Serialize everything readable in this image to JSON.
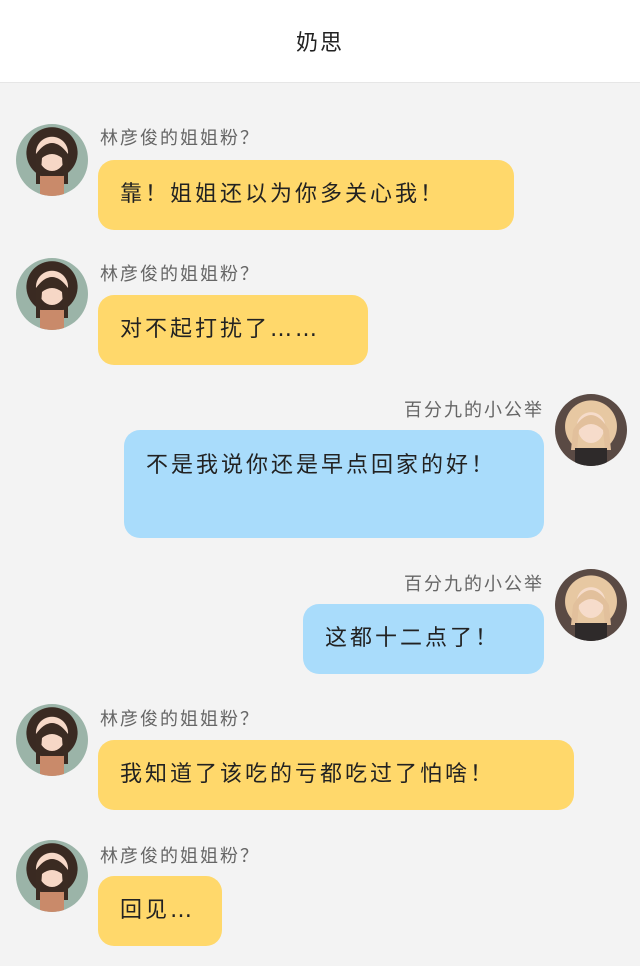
{
  "header": {
    "title": "奶思"
  },
  "messages": [
    {
      "sender": "林彦俊的姐姐粉？",
      "text": "靠！姐姐还以为你多关心我！",
      "side": "left"
    },
    {
      "sender": "林彦俊的姐姐粉？",
      "text": "对不起打扰了……",
      "side": "left"
    },
    {
      "sender": "百分九的小公举",
      "text": "不是我说你还是早点回家的好！",
      "side": "right"
    },
    {
      "sender": "百分九的小公举",
      "text": "这都十二点了！",
      "side": "right"
    },
    {
      "sender": "林彦俊的姐姐粉？",
      "text": "我知道了该吃的亏都吃过了怕啥！",
      "side": "left"
    },
    {
      "sender": "林彦俊的姐姐粉？",
      "text": "回见…",
      "side": "left"
    }
  ],
  "colors": {
    "left_bubble": "#ffd86b",
    "right_bubble": "#a9dcfb",
    "header_bg": "#ffffff",
    "page_bg": "#f3f3f3"
  }
}
